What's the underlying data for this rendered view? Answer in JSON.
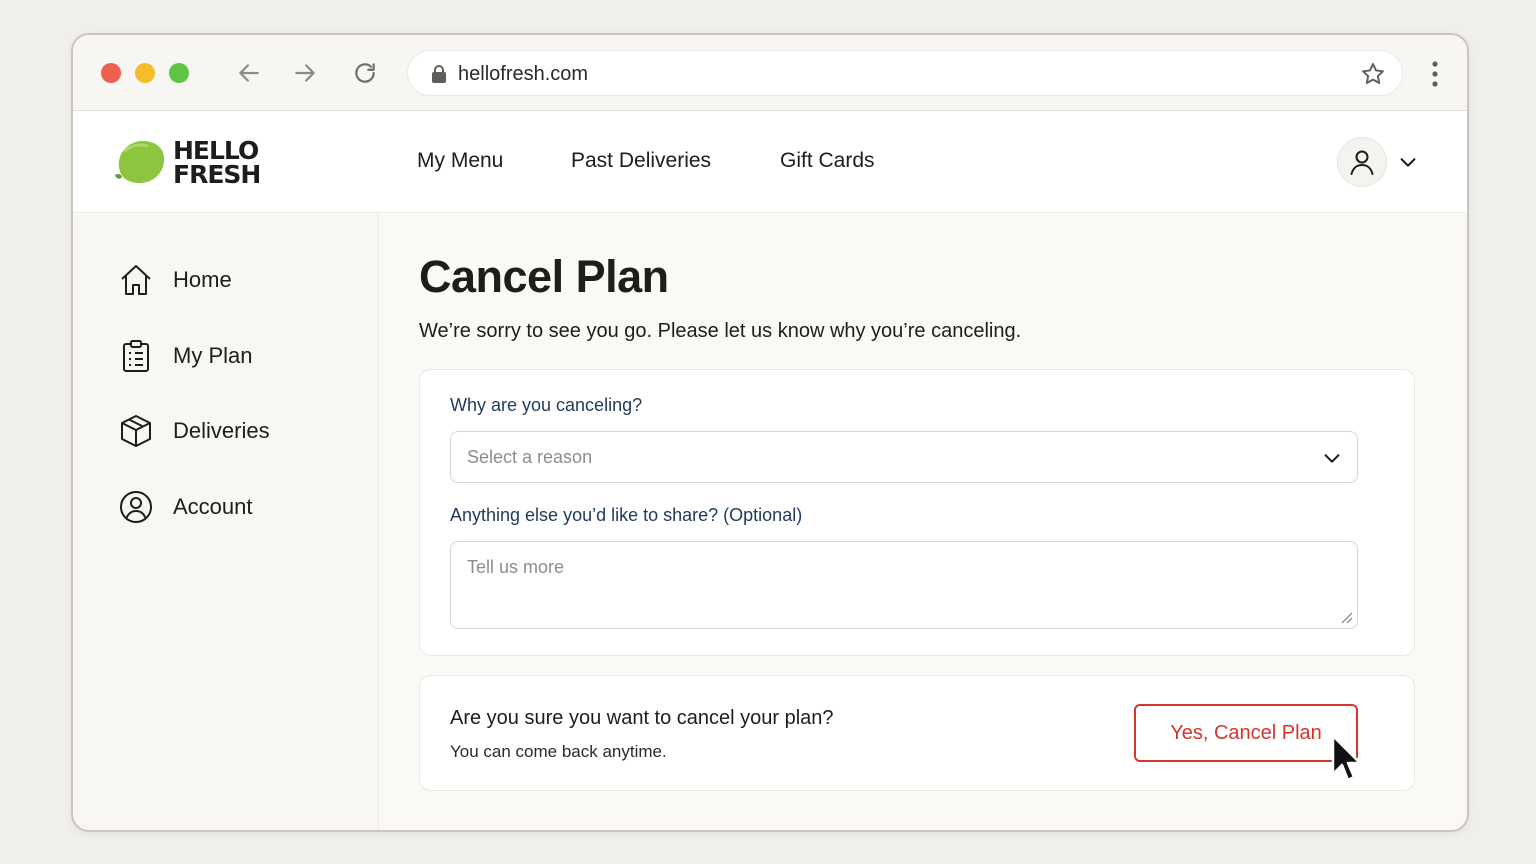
{
  "browser": {
    "url": "hellofresh.com",
    "traffic_lights": {
      "close": "#ed5f4f",
      "minimize": "#f5bd2c",
      "maximize": "#5fc443"
    }
  },
  "header": {
    "logo_line1": "HELLO",
    "logo_line2": "FRESH",
    "logo_color": "#8cc63f",
    "nav": [
      "My Menu",
      "Past Deliveries",
      "Gift Cards"
    ]
  },
  "sidebar": {
    "items": [
      {
        "label": "Home",
        "icon": "home-icon"
      },
      {
        "label": "My Plan",
        "icon": "clipboard-icon"
      },
      {
        "label": "Deliveries",
        "icon": "box-icon"
      },
      {
        "label": "Account",
        "icon": "user-circle-icon"
      }
    ]
  },
  "main": {
    "title": "Cancel Plan",
    "subtitle": "We’re sorry to see you go. Please let us know why you’re canceling.",
    "form": {
      "reason_label": "Why are you canceling?",
      "reason_placeholder": "Select a reason",
      "comments_label": "Anything else you’d like to share? (Optional)",
      "comments_placeholder": "Tell us more"
    },
    "confirm": {
      "question": "Are you sure you want to cancel your plan?",
      "note": "You can come back anytime.",
      "button_label": "Yes, Cancel Plan",
      "button_color": "#d6342c"
    }
  }
}
